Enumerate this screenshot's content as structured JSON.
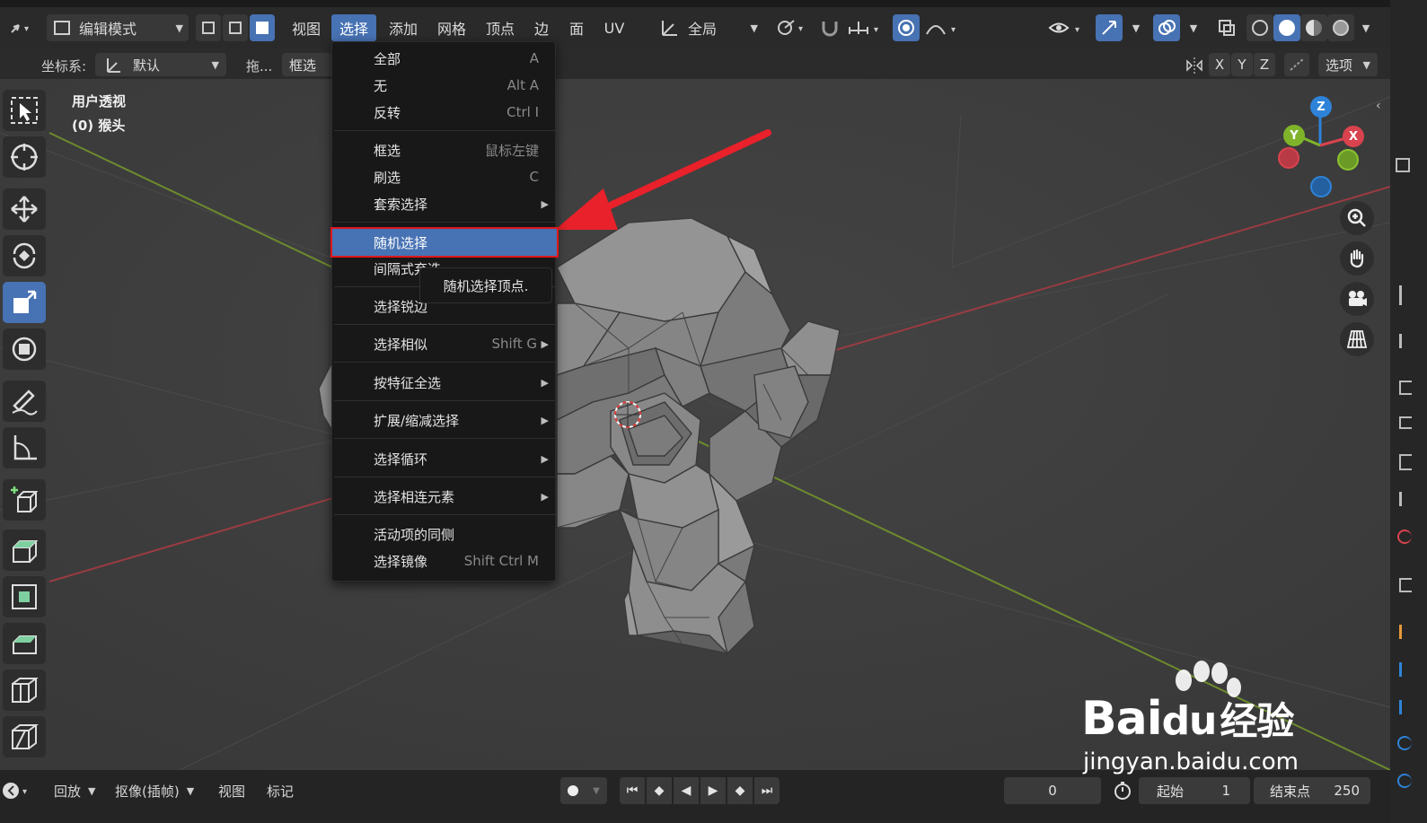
{
  "header": {
    "mode": "编辑模式",
    "menus": [
      "视图",
      "选择",
      "添加",
      "网格",
      "顶点",
      "边",
      "面",
      "UV"
    ],
    "transform_orientation": "全局"
  },
  "toolbar2": {
    "coord_label": "坐标系:",
    "coord_value": "默认",
    "drag_label": "拖...",
    "select_box_label": "框选",
    "axes": [
      "X",
      "Y",
      "Z"
    ],
    "options_label": "选项"
  },
  "viewport": {
    "view_name": "用户透视",
    "object_name": "(0) 猴头"
  },
  "select_menu": {
    "items": [
      {
        "label": "全部",
        "shortcut": "A"
      },
      {
        "label": "无",
        "shortcut": "Alt A"
      },
      {
        "label": "反转",
        "shortcut": "Ctrl I"
      },
      {
        "label": "框选",
        "shortcut": "鼠标左键"
      },
      {
        "label": "刷选",
        "shortcut": "C"
      },
      {
        "label": "套索选择",
        "shortcut": ""
      },
      {
        "label": "随机选择",
        "shortcut": ""
      },
      {
        "label": "间隔式弃选",
        "shortcut": ""
      },
      {
        "label": "选择锐边",
        "shortcut": ""
      },
      {
        "label": "选择相似",
        "shortcut": "Shift G"
      },
      {
        "label": "按特征全选",
        "shortcut": ""
      },
      {
        "label": "扩展/缩减选择",
        "shortcut": ""
      },
      {
        "label": "选择循环",
        "shortcut": ""
      },
      {
        "label": "选择相连元素",
        "shortcut": ""
      },
      {
        "label": "活动项的同侧",
        "shortcut": ""
      },
      {
        "label": "选择镜像",
        "shortcut": "Shift Ctrl M"
      }
    ],
    "highlighted": "随机选择",
    "tooltip": "随机选择顶点."
  },
  "gizmo": {
    "z": "Z",
    "y": "Y",
    "x": "X"
  },
  "timeline": {
    "playback": "回放",
    "keying": "抠像(插帧)",
    "view": "视图",
    "marker": "标记",
    "current_frame": "0",
    "start_label": "起始",
    "start_value": "1",
    "end_label": "结束点",
    "end_value": "250"
  },
  "watermark": {
    "brand": "Bai",
    "brand2": "du",
    "suffix": "经验",
    "url": "jingyan.baidu.com"
  },
  "colors": {
    "accent": "#4772b3",
    "highlight_border": "#e0161c",
    "arrow": "#e8212a",
    "axis_x": "#d9434e",
    "axis_y": "#7fb42a",
    "axis_z": "#2e83d8"
  }
}
